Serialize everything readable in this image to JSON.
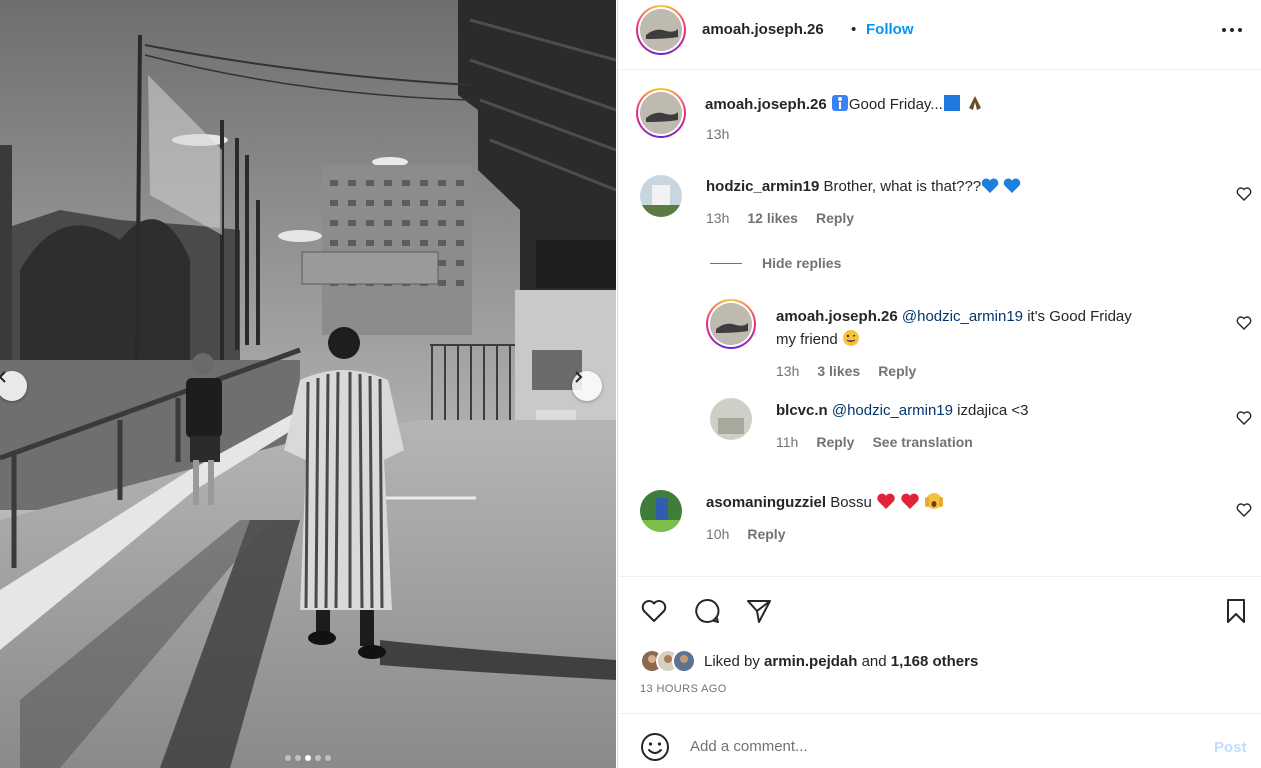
{
  "post": {
    "author": "amoah.joseph.26",
    "follow_label": "Follow",
    "separator": "•",
    "caption": {
      "username": "amoah.joseph.26",
      "text": "Good Friday...",
      "time": "13h"
    },
    "carousel": {
      "slides": 5,
      "active_index": 2
    }
  },
  "comments": [
    {
      "username": "hodzic_armin19",
      "text": "Brother, what is that???",
      "emojis": [
        "blue-heart",
        "blue-heart"
      ],
      "time": "13h",
      "likes": "12 likes",
      "reply_label": "Reply"
    }
  ],
  "hide_replies_label": "Hide replies",
  "replies": [
    {
      "username": "amoah.joseph.26",
      "mention": "@hodzic_armin19",
      "text_line1": "it's Good Friday",
      "text_line2": "my friend",
      "time": "13h",
      "likes": "3 likes",
      "reply_label": "Reply"
    },
    {
      "username": "blcvc.n",
      "mention": "@hodzic_armin19",
      "text": "izdajica <3",
      "time": "11h",
      "reply_label": "Reply",
      "translate_label": "See translation"
    }
  ],
  "comment3": {
    "username": "asomaninguzziel",
    "text": "Bossu",
    "time": "10h",
    "reply_label": "Reply"
  },
  "likes_summary": {
    "prefix": "Liked by",
    "user": "armin.pejdah",
    "middle": "and",
    "count": "1,168 others"
  },
  "timestamp": "13 HOURS AGO",
  "composer": {
    "placeholder": "Add a comment...",
    "post_label": "Post"
  },
  "colors": {
    "accent": "#0095f6",
    "text": "#262626",
    "muted": "#737373",
    "post_disabled": "#c0dffd",
    "mention": "#00376b"
  }
}
